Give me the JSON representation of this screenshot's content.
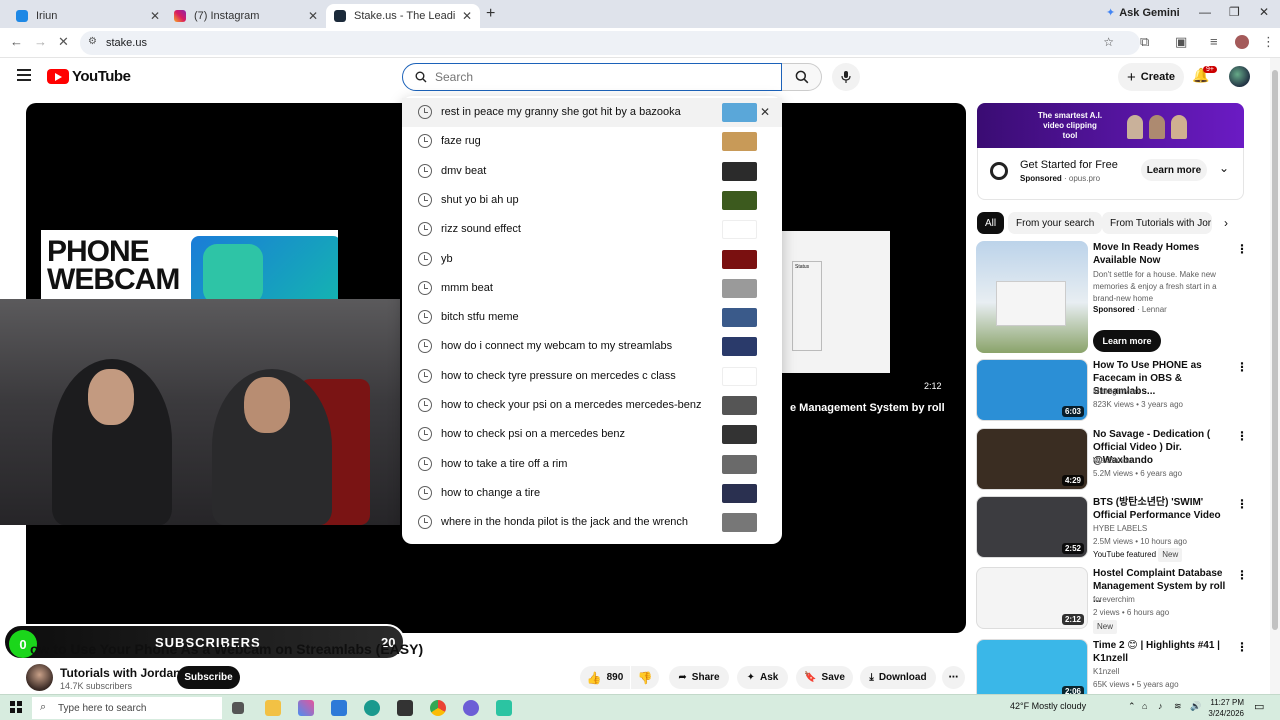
{
  "browser": {
    "tabs": [
      {
        "title": "Iriun"
      },
      {
        "title": "(7) Instagram"
      },
      {
        "title": "Stake.us - The Leading Social C"
      }
    ],
    "gemini_label": "Ask Gemini",
    "url": "stake.us"
  },
  "youtube": {
    "logo_text": "YouTube",
    "search": {
      "placeholder": "Search",
      "value": ""
    },
    "create_label": "Create",
    "notifications_badge": "9+"
  },
  "suggestions": [
    {
      "text": "rest in peace my granny she got hit by a bazooka",
      "thumb_color": "#5aa7d9"
    },
    {
      "text": "faze rug",
      "thumb_color": "#c89a58"
    },
    {
      "text": "dmv beat",
      "thumb_color": "#2b2b2b"
    },
    {
      "text": "shut yo bi ah up",
      "thumb_color": "#3c5a1e"
    },
    {
      "text": "rizz sound effect",
      "thumb_color": "#ffffff"
    },
    {
      "text": "yb",
      "thumb_color": "#7a1010"
    },
    {
      "text": "mmm beat",
      "thumb_color": "#9a9a9a"
    },
    {
      "text": "bitch stfu meme",
      "thumb_color": "#3a5a8a"
    },
    {
      "text": "how do i connect my webcam to my streamlabs",
      "thumb_color": "#2a3a6a"
    },
    {
      "text": "how to check tyre pressure on mercedes c class",
      "thumb_color": "#ffffff"
    },
    {
      "text": "how to check your psi on a mercedes mercedes-benz",
      "thumb_color": "#555555"
    },
    {
      "text": "how to check psi on a mercedes benz",
      "thumb_color": "#333333"
    },
    {
      "text": "how to take a tire off a rim",
      "thumb_color": "#6a6a6a"
    },
    {
      "text": "how to change a tire",
      "thumb_color": "#2a3050"
    },
    {
      "text": "where in the honda pilot is the jack and the wrench",
      "thumb_color": "#777777"
    }
  ],
  "player": {
    "thumb_title": "PHONE WEBCAM",
    "duration": "2:12",
    "overlay_title": "e Management System by roll",
    "inner_status": "Status",
    "subs_overlay": {
      "count": "0",
      "label": "SUBSCRIBERS",
      "goal": "20"
    }
  },
  "video": {
    "title": "ow to Use Your Phone As a Webcam on Streamlabs (EASY)",
    "channel": "Tutorials with Jordan",
    "subscribers": "14.7K subscribers",
    "subscribe_label": "Subscribe",
    "likes": "890",
    "share_label": "Share",
    "ask_label": "Ask",
    "save_label": "Save",
    "download_label": "Download"
  },
  "ad": {
    "banner_text": "The smartest A.I. video clipping tool",
    "title": "Get Started for Free",
    "sponsored": "Sponsored",
    "domain": "opus.pro",
    "cta": "Learn more"
  },
  "chips": [
    "All",
    "From your search",
    "From Tutorials with Jor"
  ],
  "recommendations": [
    {
      "title": "Move In Ready Homes Available Now",
      "desc": "Don't settle for a house. Make new memories & enjoy a fresh start in a brand-new home",
      "sponsored": "Sponsored",
      "advertiser": "Lennar",
      "cta": "Learn more",
      "thumb_color": "#cfd8e0"
    },
    {
      "title": "How To Use PHONE as Facecam in OBS & Streamlabs...",
      "channel": "MidnightMan",
      "stats": "823K views • 3 years ago",
      "duration": "6:03",
      "thumb_color": "#2b8fd6"
    },
    {
      "title": "No Savage - Dedication ( Official Video ) Dir. @Waxbando",
      "channel": "WaxBando",
      "stats": "5.2M views • 6 years ago",
      "duration": "4:29",
      "thumb_color": "#3a2d22"
    },
    {
      "title": "BTS (방탄소년단) 'SWIM' Official Performance Video",
      "channel": "HYBE LABELS",
      "stats": "2.5M views • 10 hours ago",
      "extra": "YouTube featured",
      "badge": "New",
      "duration": "2:52",
      "thumb_color": "#3c3c40"
    },
    {
      "title": "Hostel Complaint  Database Management System by roll ...",
      "channel": "foreverchim",
      "stats": "2 views • 6 hours ago",
      "badge": "New",
      "duration": "2:12",
      "thumb_color": "#f4f4f4"
    },
    {
      "title": "Time 2 😊 | Highlights #41 | K1nzell",
      "channel": "K1nzell",
      "stats": "65K views • 5 years ago",
      "duration": "2:06",
      "thumb_color": "#3ab7e8"
    }
  ],
  "taskbar": {
    "search_placeholder": "Type here to search",
    "weather": "42°F  Mostly cloudy",
    "time": "11:27 PM",
    "date": "3/24/2026"
  }
}
